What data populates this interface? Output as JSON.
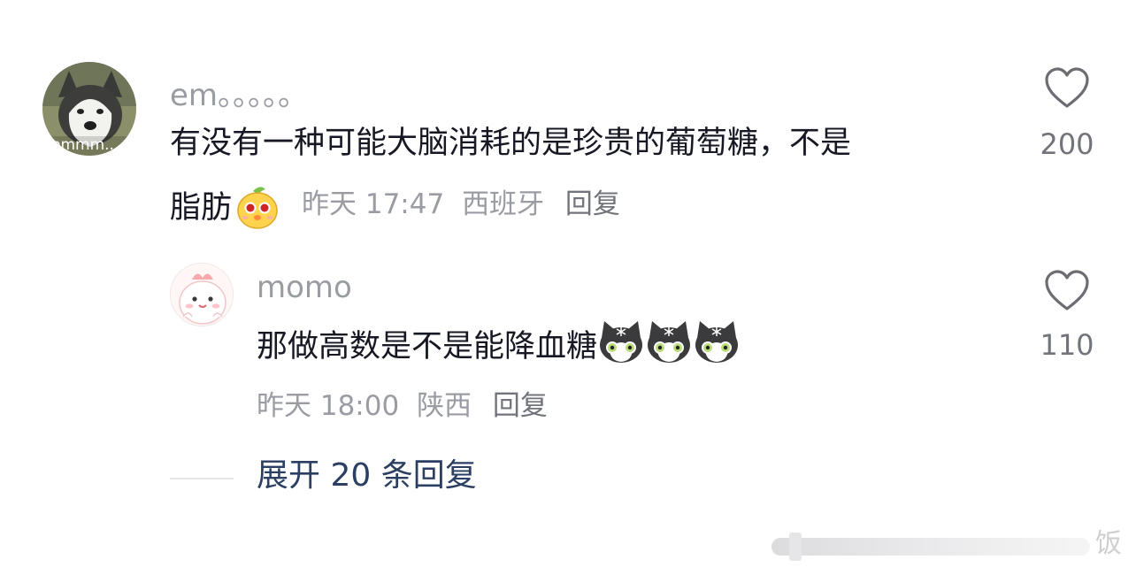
{
  "comments": [
    {
      "username": "em。。。。。",
      "avatar_text": "emmm...",
      "text_line1": "有没有一种可能大脑消耗的是珍贵的葡萄糖，不是",
      "text_line2": "脂肪",
      "time": "昨天 17:47",
      "location": "西班牙",
      "reply_label": "回复",
      "likes": "200"
    },
    {
      "username": "momo",
      "text": "那做高数是不是能降血糖",
      "time": "昨天 18:00",
      "location": "陕西",
      "reply_label": "回复",
      "likes": "110"
    }
  ],
  "expand_replies": "展开 20 条回复",
  "watermark_text": "饭",
  "icons": {
    "like": "heart-outline-icon",
    "emoji1": "yellow-chick-emoji",
    "emoji2": "tuxedo-cat-emoji"
  },
  "colors": {
    "primary_text": "#161823",
    "secondary_text": "#9a9ca3",
    "link": "#2b3f63"
  }
}
